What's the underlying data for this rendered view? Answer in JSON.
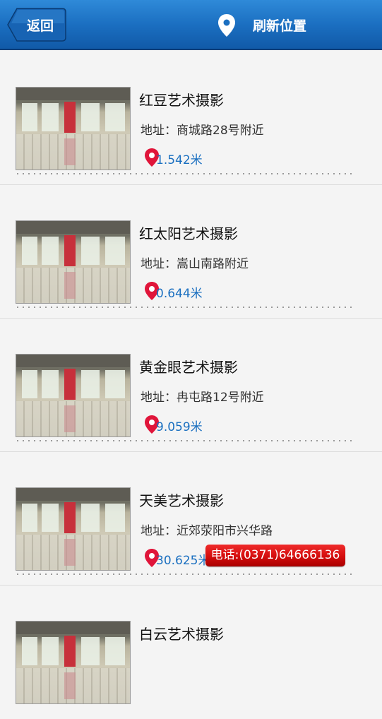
{
  "header": {
    "back_label": "返回",
    "refresh_label": "刷新位置",
    "bar_color": "#1b6fc1"
  },
  "stores": [
    {
      "name": "红豆艺术摄影",
      "address": "地址：商城路28号附近",
      "distance": "1.542米"
    },
    {
      "name": "红太阳艺术摄影",
      "address": "地址：嵩山南路附近",
      "distance": "0.644米"
    },
    {
      "name": "黄金眼艺术摄影",
      "address": "地址：冉屯路12号附近",
      "distance": "9.059米"
    },
    {
      "name": "天美艺术摄影",
      "address": "地址：近郊荥阳市兴华路",
      "distance": "30.625米",
      "phone": "电话:(0371)64666136"
    },
    {
      "name": "白云艺术摄影"
    }
  ],
  "icons": {
    "back": "back-arrow-button",
    "refresh": "location-pin-icon",
    "distance": "map-marker-icon"
  }
}
